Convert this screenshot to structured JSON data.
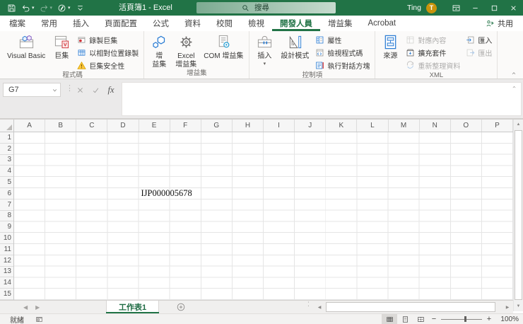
{
  "colors": {
    "accent_green": "#217346",
    "avatar_orange": "#c9940c"
  },
  "titlebar": {
    "title": "活頁簿1 - Excel",
    "search_placeholder": "搜尋",
    "user_name": "Ting",
    "avatar_initial": "T"
  },
  "quick_access": {
    "items": [
      {
        "icon": "save-icon"
      },
      {
        "icon": "undo-icon",
        "arrow": true
      },
      {
        "icon": "redo-icon",
        "arrow": true,
        "disabled": true
      },
      {
        "icon": "ink-pen-icon",
        "arrow": true
      },
      {
        "icon": "qat-customize-icon"
      }
    ]
  },
  "window_controls": [
    {
      "icon": "ribbon-display-options-icon"
    },
    {
      "icon": "minimize-icon"
    },
    {
      "icon": "maximize-icon"
    },
    {
      "icon": "close-icon"
    }
  ],
  "ribbon_tabs": [
    {
      "label": "檔案"
    },
    {
      "label": "常用"
    },
    {
      "label": "插入"
    },
    {
      "label": "頁面配置"
    },
    {
      "label": "公式"
    },
    {
      "label": "資料"
    },
    {
      "label": "校閱"
    },
    {
      "label": "檢視"
    },
    {
      "label": "開發人員",
      "active": true
    },
    {
      "label": "增益集"
    },
    {
      "label": "Acrobat"
    }
  ],
  "share": {
    "label": "共用",
    "icon": "share-icon"
  },
  "ribbon_groups": [
    {
      "label": "程式碼",
      "items": [
        {
          "type": "large",
          "label": "Visual Basic",
          "icon": "vb-cubes-icon"
        },
        {
          "type": "large",
          "label": "巨集",
          "icon": "macros-icon"
        },
        {
          "type": "smallcol",
          "items": [
            {
              "label": "錄製巨集",
              "icon": "record-macro-icon"
            },
            {
              "label": "以相對位置錄製",
              "icon": "relative-references-icon"
            },
            {
              "label": "巨集安全性",
              "icon": "macro-security-warning-icon"
            }
          ]
        }
      ]
    },
    {
      "label": "增益集",
      "items": [
        {
          "type": "large",
          "label": "增\n益集",
          "icon": "addins-hexagon-icon"
        },
        {
          "type": "large",
          "label": "Excel\n增益集",
          "icon": "gear-icon"
        },
        {
          "type": "large",
          "label": "COM 增益集",
          "icon": "com-addins-icon"
        }
      ]
    },
    {
      "label": "控制項",
      "items": [
        {
          "type": "large",
          "label": "插入",
          "icon": "toolbox-icon",
          "dropdown": true
        },
        {
          "type": "large",
          "label": "設計模式",
          "icon": "design-mode-icon"
        },
        {
          "type": "smallcol",
          "items": [
            {
              "label": "屬性",
              "icon": "properties-icon"
            },
            {
              "label": "檢視程式碼",
              "icon": "view-code-icon"
            },
            {
              "label": "執行對話方塊",
              "icon": "run-dialog-icon"
            }
          ]
        }
      ]
    },
    {
      "label": "XML",
      "items": [
        {
          "type": "large",
          "label": "來源",
          "icon": "xml-source-icon"
        },
        {
          "type": "smallcol",
          "items": [
            {
              "label": "對應內容",
              "icon": "map-properties-icon",
              "disabled": true
            },
            {
              "label": "擴充套件",
              "icon": "expansion-packs-icon"
            },
            {
              "label": "重新整理資料",
              "icon": "refresh-data-icon",
              "disabled": true
            }
          ]
        },
        {
          "type": "smallcol",
          "items": [
            {
              "label": "匯入",
              "icon": "import-icon"
            },
            {
              "label": "匯出",
              "icon": "export-icon",
              "disabled": true
            }
          ]
        }
      ]
    }
  ],
  "formula_bar": {
    "name_box_value": "G7",
    "fx_label": "fx",
    "formula_value": ""
  },
  "grid": {
    "column_headers": [
      "A",
      "B",
      "C",
      "D",
      "E",
      "F",
      "G",
      "H",
      "I",
      "J",
      "K",
      "L",
      "M",
      "N",
      "O",
      "P"
    ],
    "row_headers": [
      "1",
      "2",
      "3",
      "4",
      "5",
      "6",
      "7",
      "8",
      "9",
      "10",
      "11",
      "12",
      "13",
      "14",
      "15"
    ],
    "cells": [
      {
        "ref": "E6",
        "text": "IJP000005678"
      }
    ]
  },
  "sheet_bar": {
    "sheet_tabs": [
      {
        "label": "工作表1",
        "active": true
      }
    ]
  },
  "status_bar": {
    "mode_label": "就緒",
    "view_icons": [
      {
        "name": "normal-view-icon",
        "active": true
      },
      {
        "name": "page-layout-view-icon"
      },
      {
        "name": "page-break-view-icon"
      }
    ],
    "zoom_label": "100%"
  }
}
